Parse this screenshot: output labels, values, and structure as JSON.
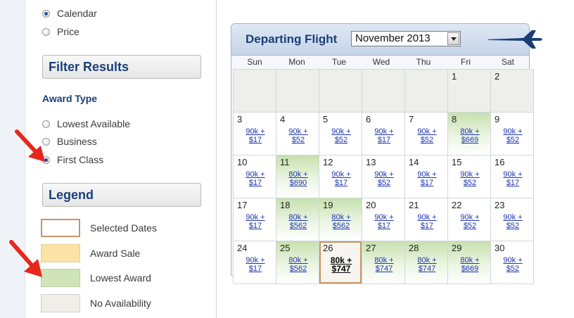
{
  "sort_options": [
    {
      "label": "Calendar",
      "checked": true
    },
    {
      "label": "Price",
      "checked": false
    }
  ],
  "filter": {
    "title": "Filter Results",
    "award_type_label": "Award Type",
    "options": [
      {
        "label": "Lowest Available",
        "checked": false
      },
      {
        "label": "Business",
        "checked": false
      },
      {
        "label": "First Class",
        "checked": true
      }
    ]
  },
  "legend": {
    "title": "Legend",
    "items": [
      {
        "label": "Selected Dates",
        "color": "#ffffff",
        "border": "#c8956a"
      },
      {
        "label": "Award Sale",
        "color": "#fbe3a6",
        "border": "#e5cf95"
      },
      {
        "label": "Lowest Award",
        "color": "#cfe5b9",
        "border": "#b8d3a0"
      },
      {
        "label": "No Availability",
        "color": "#efeee8",
        "border": "#cfcfcf"
      }
    ]
  },
  "calendar": {
    "title": "Departing Flight",
    "selected_month": "November 2013",
    "weekdays": [
      "Sun",
      "Mon",
      "Tue",
      "Wed",
      "Thu",
      "Fri",
      "Sat"
    ],
    "weeks": [
      [
        {
          "day": "",
          "fare": "",
          "state": "empty"
        },
        {
          "day": "",
          "fare": "",
          "state": "empty"
        },
        {
          "day": "",
          "fare": "",
          "state": "empty"
        },
        {
          "day": "",
          "fare": "",
          "state": "empty"
        },
        {
          "day": "",
          "fare": "",
          "state": "empty"
        },
        {
          "day": "1",
          "fare": "",
          "state": "empty"
        },
        {
          "day": "2",
          "fare": "",
          "state": "empty"
        }
      ],
      [
        {
          "day": "3",
          "fare": "90k + $17",
          "state": "normal"
        },
        {
          "day": "4",
          "fare": "90k + $52",
          "state": "normal"
        },
        {
          "day": "5",
          "fare": "90k + $52",
          "state": "normal"
        },
        {
          "day": "6",
          "fare": "90k + $17",
          "state": "normal"
        },
        {
          "day": "7",
          "fare": "90k + $52",
          "state": "normal"
        },
        {
          "day": "8",
          "fare": "80k + $669",
          "state": "lowest"
        },
        {
          "day": "9",
          "fare": "90k + $52",
          "state": "normal"
        }
      ],
      [
        {
          "day": "10",
          "fare": "90k + $17",
          "state": "normal"
        },
        {
          "day": "11",
          "fare": "80k + $690",
          "state": "lowest"
        },
        {
          "day": "12",
          "fare": "90k + $17",
          "state": "normal"
        },
        {
          "day": "13",
          "fare": "90k + $52",
          "state": "normal"
        },
        {
          "day": "14",
          "fare": "90k + $17",
          "state": "normal"
        },
        {
          "day": "15",
          "fare": "90k + $52",
          "state": "normal"
        },
        {
          "day": "16",
          "fare": "90k + $17",
          "state": "normal"
        }
      ],
      [
        {
          "day": "17",
          "fare": "90k + $17",
          "state": "normal"
        },
        {
          "day": "18",
          "fare": "80k + $562",
          "state": "lowest"
        },
        {
          "day": "19",
          "fare": "80k + $562",
          "state": "lowest"
        },
        {
          "day": "20",
          "fare": "90k + $17",
          "state": "normal"
        },
        {
          "day": "21",
          "fare": "90k + $17",
          "state": "normal"
        },
        {
          "day": "22",
          "fare": "90k + $52",
          "state": "normal"
        },
        {
          "day": "23",
          "fare": "90k + $52",
          "state": "normal"
        }
      ],
      [
        {
          "day": "24",
          "fare": "90k + $17",
          "state": "normal"
        },
        {
          "day": "25",
          "fare": "80k + $562",
          "state": "lowest"
        },
        {
          "day": "26",
          "fare": "80k + $747",
          "state": "selected"
        },
        {
          "day": "27",
          "fare": "80k + $747",
          "state": "lowest"
        },
        {
          "day": "28",
          "fare": "80k + $747",
          "state": "lowest"
        },
        {
          "day": "29",
          "fare": "80k + $669",
          "state": "lowest"
        },
        {
          "day": "30",
          "fare": "90k + $52",
          "state": "normal"
        }
      ]
    ]
  },
  "annotations": {
    "arrow_color": "#e8261c"
  },
  "icons": {
    "plane": "airplane-icon",
    "dropdown": "chevron-down-icon",
    "arrow": "red-arrow-icon"
  }
}
